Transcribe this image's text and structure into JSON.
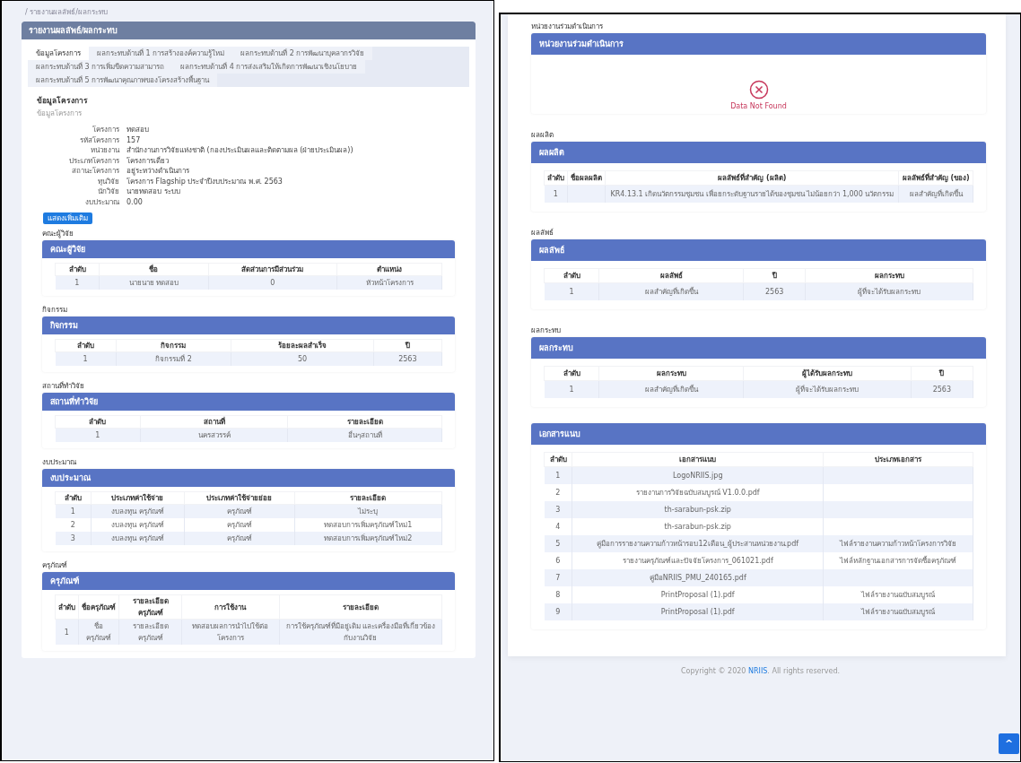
{
  "left_panel": {
    "breadcrumb": "/ รายงานผลลัพธ์/ผลกระทบ",
    "title": "รายงานผลลัพธ์/ผลกระทบ",
    "tabs": [
      {
        "label": "ข้อมูลโครงการ",
        "selected": true
      },
      {
        "label": "ผลกระทบด้านที่ 1 การสร้างองค์ความรู้ใหม่",
        "selected": false
      },
      {
        "label": "ผลกระทบด้านที่ 2 การพัฒนาบุคลากรวิจัย",
        "selected": false
      },
      {
        "label": "ผลกระทบด้านที่ 3 การเพิ่มขีดความสามารถ",
        "selected": false
      },
      {
        "label": "ผลกระทบด้านที่ 4 การส่งเสริมให้เกิดการพัฒนาเชิงนโยบาย",
        "selected": false
      },
      {
        "label": "ผลกระทบด้านที่ 5 การพัฒนาคุณภาพของโครงสร้างพื้นฐาน",
        "selected": false
      }
    ],
    "project_info": {
      "title": "ข้อมูลโครงการ",
      "subtitle": "ข้อมูลโครงการ",
      "fields": [
        {
          "label": "โครงการ",
          "value": "ทดสอบ"
        },
        {
          "label": "รหัสโครงการ",
          "value": "157"
        },
        {
          "label": "หน่วยงาน",
          "value": "สำนักงานการวิจัยแห่งชาติ (กองประเมินผลและติดตามผล (ฝ่ายประเมินผล))"
        },
        {
          "label": "ประเภทโครงการ",
          "value": "โครงการเดี่ยว"
        },
        {
          "label": "สถานะโครงการ",
          "value": "อยู่ระหว่างดำเนินการ"
        },
        {
          "label": "ทุนวิจัย",
          "value": "โครงการ Flagship ประจำปีงบประมาณ พ.ศ. 2563"
        },
        {
          "label": "นักวิจัย",
          "value": "นายทดสอบ ระบบ"
        },
        {
          "label": "งบประมาณ",
          "value": "0.00"
        }
      ]
    },
    "button": "แสดงเพิ่มเติม",
    "sections": [
      {
        "kind": "table",
        "label": "คณะผู้วิจัย",
        "title": "คณะผู้วิจัย",
        "columns": [
          "ลำดับ",
          "ชื่อ",
          "สัดส่วนการมีส่วนร่วม",
          "ตำแหน่ง"
        ],
        "rows": [
          [
            "1",
            "นายนาย ทดสอบ",
            "0",
            "หัวหน้าโครงการ"
          ]
        ]
      },
      {
        "kind": "table",
        "label": "กิจกรรม",
        "title": "กิจกรรม",
        "columns": [
          "ลำดับ",
          "กิจกรรม",
          "ร้อยละผลสำเร็จ",
          "ปี"
        ],
        "rows": [
          [
            "1",
            "กิจกรรมที่ 2",
            "50",
            "2563"
          ]
        ]
      },
      {
        "kind": "table",
        "label": "สถานที่ทำวิจัย",
        "title": "สถานที่ทำวิจัย",
        "columns": [
          "ลำดับ",
          "สถานที่",
          "รายละเอียด"
        ],
        "rows": [
          [
            "1",
            "นครสวรรค์",
            "อื่นๆสถานที่"
          ]
        ]
      },
      {
        "kind": "table",
        "label": "งบประมาณ",
        "title": "งบประมาณ",
        "columns": [
          "ลำดับ",
          "ประเภทค่าใช้จ่าย",
          "ประเภทค่าใช้จ่ายย่อย",
          "รายละเอียด"
        ],
        "rows": [
          [
            "1",
            "งบลงทุน ครุภัณฑ์",
            "ครุภัณฑ์",
            "ไม่ระบุ"
          ],
          [
            "2",
            "งบลงทุน ครุภัณฑ์",
            "ครุภัณฑ์",
            "ทดสอบการเพิ่มครุภัณฑ์ใหม่1"
          ],
          [
            "3",
            "งบลงทุน ครุภัณฑ์",
            "ครุภัณฑ์",
            "ทดสอบการเพิ่มครุภัณฑ์ใหม่2"
          ]
        ]
      },
      {
        "kind": "table",
        "label": "ครุภัณฑ์",
        "title": "ครุภัณฑ์",
        "columns": [
          "ลำดับ",
          "ชื่อครุภัณฑ์",
          "รายละเอียดครุภัณฑ์",
          "การใช้งาน",
          "รายละเอียด"
        ],
        "rows": [
          [
            "1",
            "ชื่อครุภัณฑ์",
            "รายละเอียดครุภัณฑ์",
            "ทดสอบผลการนำไปใช้ต่อโครงการ",
            "การใช้ครุภัณฑ์ที่มีอยู่เดิม และเครื่องมือที่เกี่ยวข้องกับงานวิจัย"
          ]
        ]
      }
    ]
  },
  "right_panel": {
    "sections": [
      {
        "kind": "empty",
        "label": "หน่วยงานร่วมดำเนินการ",
        "title": "หน่วยงานร่วมดำเนินการ",
        "message": "Data Not Found"
      },
      {
        "kind": "table",
        "label": "ผลผลิต",
        "title": "ผลผลิต",
        "columns": [
          "ลำดับ",
          "ชื่อผลผลิต",
          "ผลลัพธ์ที่สำคัญ (ผลิต)",
          "ผลลัพธ์ที่สำคัญ (ของ)"
        ],
        "rows": [
          [
            "1",
            null,
            "KR4.13.1 เกิดนวัตกรรมชุมชน เพื่อยกระดับฐานรายได้ของชุมชน ไม่น้อยกว่า 1,000 นวัตกรรม",
            "ผลสำคัญที่เกิดขึ้น"
          ]
        ]
      },
      {
        "kind": "table",
        "label": "ผลลัพธ์",
        "title": "ผลลัพธ์",
        "columns": [
          "ลำดับ",
          "ผลลัพธ์",
          "ปี",
          "ผลกระทบ"
        ],
        "rows": [
          [
            "1",
            "ผลสำคัญที่เกิดขึ้น",
            "2563",
            "ผู้ที่จะได้รับผลกระทบ"
          ]
        ]
      },
      {
        "kind": "table",
        "label": "ผลกระทบ",
        "title": "ผลกระทบ",
        "columns": [
          "ลำดับ",
          "ผลกระทบ",
          "ผู้ได้รับผลกระทบ",
          "ปี"
        ],
        "rows": [
          [
            "1",
            "ผลสำคัญที่เกิดขึ้น",
            "ผู้ที่จะได้รับผลกระทบ",
            "2563"
          ]
        ]
      },
      {
        "kind": "table",
        "title": "เอกสารแนบ",
        "columns": [
          "ลำดับ",
          "เอกสารแนบ",
          "ประเภทเอกสาร"
        ],
        "rows": [
          [
            "1",
            "LogoNRIIS.jpg",
            null
          ],
          [
            "2",
            "รายงานการวิจัยฉบับสมบูรณ์ V1.0.0.pdf",
            null
          ],
          [
            "3",
            "th-sarabun-psk.zip",
            null
          ],
          [
            "4",
            "th-sarabun-psk.zip",
            null
          ],
          [
            "5",
            "คู่มือการรายงานความก้าวหน้ารอบ12เดือน_ผู้ประสานหน่วยงาน.pdf",
            "ไฟล์รายงานความก้าวหน้าโครงการวิจัย"
          ],
          [
            "6",
            "รายงานครุภัณฑ์และปัจจัยโครงการ_061021.pdf",
            "ไฟล์หลักฐานเอกสารการจัดซื้อครุภัณฑ์"
          ],
          [
            "7",
            "คู่มือNRIIS_PMU_240165.pdf",
            null
          ],
          [
            "8",
            "PrintProposal (1).pdf",
            "ไฟล์รายงานฉบับสมบูรณ์"
          ],
          [
            "9",
            "PrintProposal (1).pdf",
            "ไฟล์รายงานฉบับสมบูรณ์"
          ]
        ]
      }
    ],
    "footer": {
      "text_start": "Copyright © 2020 ",
      "link": "NRIIS",
      "text_end": ". All rights reserved."
    },
    "scroll_top_button": {
      "icon": "^"
    }
  }
}
